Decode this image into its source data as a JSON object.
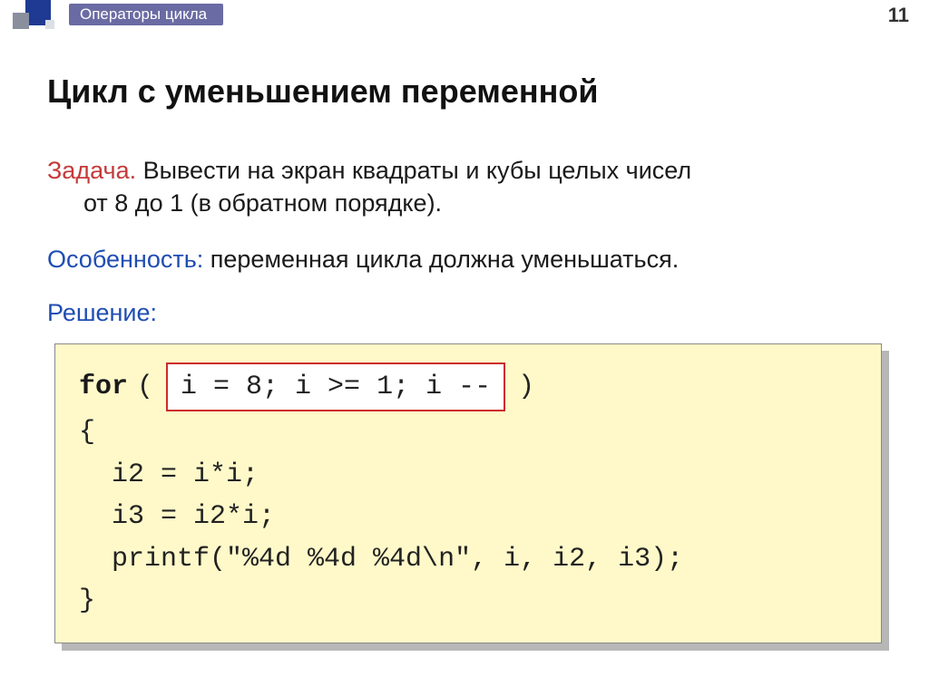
{
  "header": {
    "breadcrumb": "Операторы цикла",
    "page_number": "11"
  },
  "title": "Цикл с уменьшением переменной",
  "task": {
    "label": "Задача.",
    "text_line1": " Вывести на экран квадраты и кубы целых чисел",
    "text_line2": "от 8 до 1 (в обратном порядке)."
  },
  "feature": {
    "label": "Особенность:",
    "text": " переменная цикла должна уменьшаться."
  },
  "solution": {
    "label": "Решение:"
  },
  "code": {
    "for_kw": "for",
    "for_open": " ( ",
    "highlight": "i = 8; i >= 1; i --",
    "for_close": " )",
    "line_brace_open": "{",
    "line_i2": "  i2 = i*i;",
    "line_i3": "  i3 = i2*i;",
    "line_printf": "  printf(\"%4d %4d %4d\\n\", i, i2, i3);",
    "line_brace_close": "}"
  }
}
